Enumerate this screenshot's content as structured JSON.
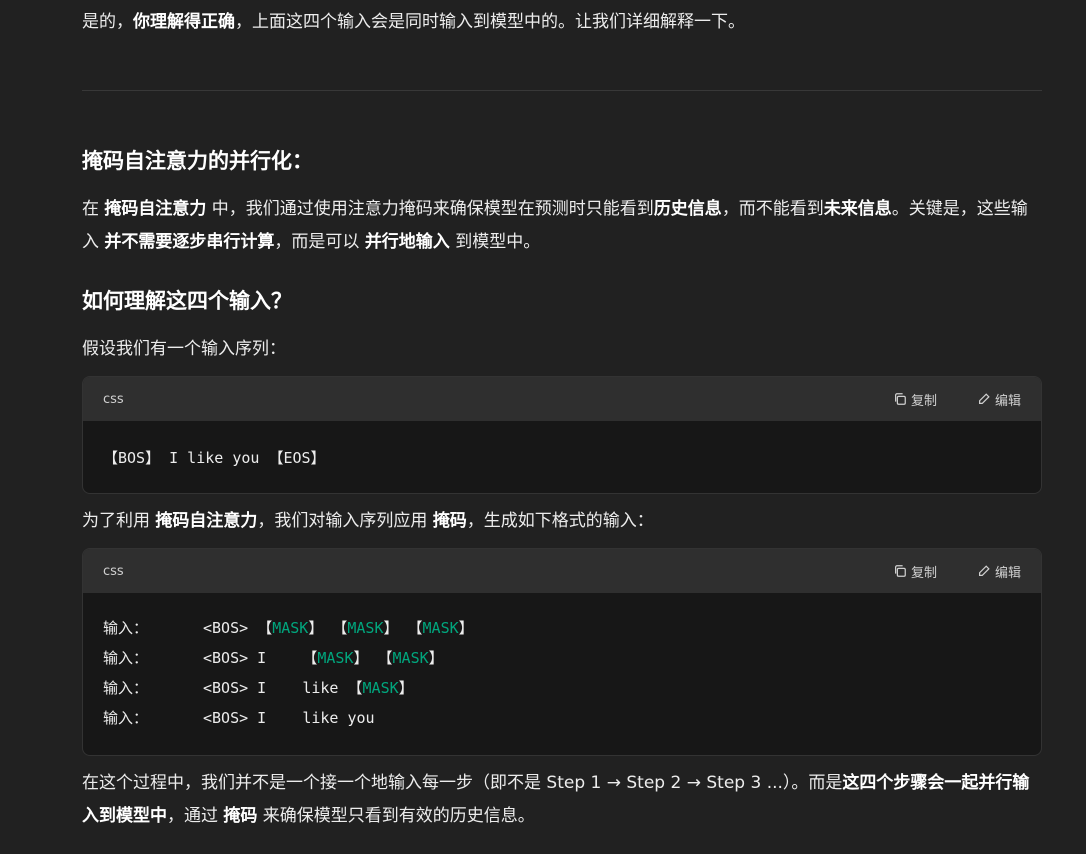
{
  "para1": {
    "t1": "是的，",
    "b1": "你理解得正确",
    "t2": "，上面这四个输入会是同时输入到模型中的。让我们详细解释一下。"
  },
  "heading1": "掩码自注意力的并行化：",
  "para2": {
    "t1": "在 ",
    "b1": "掩码自注意力",
    "t2": " 中，我们通过使用注意力掩码来确保模型在预测时只能看到",
    "b2": "历史信息",
    "t3": "，而不能看到",
    "b3": "未来信息",
    "t4": "。关键是，这些输入 ",
    "b4": "并不需要逐步串行计算",
    "t5": "，而是可以 ",
    "b5": "并行地输入",
    "t6": " 到模型中。"
  },
  "heading2": "如何理解这四个输入？",
  "para3": "假设我们有一个输入序列：",
  "code1": {
    "lang": "css",
    "copy": "复制",
    "edit": "编辑",
    "line": "【BOS】 I like you 【EOS】"
  },
  "para4": {
    "t1": "为了利用 ",
    "b1": "掩码自注意力",
    "t2": "，我们对输入序列应用 ",
    "b2": "掩码",
    "t3": "，生成如下格式的输入："
  },
  "code2": {
    "lang": "css",
    "copy": "复制",
    "edit": "编辑",
    "lines": [
      {
        "label": "输入：",
        "pre": "<BOS> ",
        "rest": [
          {
            "b": "【"
          },
          {
            "m": "MASK"
          },
          {
            "b": "】 【"
          },
          {
            "m": "MASK"
          },
          {
            "b": "】 【"
          },
          {
            "m": "MASK"
          },
          {
            "b": "】"
          }
        ]
      },
      {
        "label": "输入：",
        "pre": "<BOS> I    ",
        "rest": [
          {
            "b": "【"
          },
          {
            "m": "MASK"
          },
          {
            "b": "】 【"
          },
          {
            "m": "MASK"
          },
          {
            "b": "】"
          }
        ]
      },
      {
        "label": "输入：",
        "pre": "<BOS> I    like ",
        "rest": [
          {
            "b": "【"
          },
          {
            "m": "MASK"
          },
          {
            "b": "】"
          }
        ]
      },
      {
        "label": "输入：",
        "pre": "<BOS> I    like you",
        "rest": []
      }
    ]
  },
  "para5": {
    "t1": "在这个过程中，我们并不是一个接一个地输入每一步（即不是 Step 1 → Step 2 → Step 3 ...）。而是",
    "b1": "这四个步骤会一起并行输入到模型中",
    "t2": "，通过 ",
    "b2": "掩码",
    "t3": " 来确保模型只看到有效的历史信息。"
  }
}
